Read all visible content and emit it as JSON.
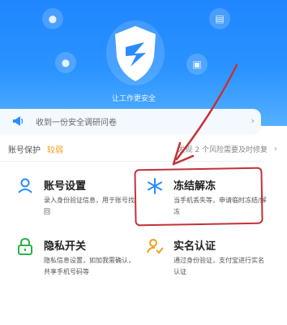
{
  "hero": {
    "slogan": "让工作更安全",
    "colors": {
      "top": "#1f86ff",
      "bottom": "#55b0ff"
    }
  },
  "survey": {
    "icon": "megaphone-icon",
    "text": "收到一份安全调研问卷",
    "arrow": "›"
  },
  "security": {
    "label": "账号保护",
    "level": "较弱",
    "warning": "发现 2 个风险需要及时修复",
    "arrow": "›"
  },
  "cards": [
    {
      "icon": "user-icon",
      "title": "账号设置",
      "desc": "录入身份验证信息，用于账号找回"
    },
    {
      "icon": "snowflake-icon",
      "title": "冻结解冻",
      "desc": "当手机丢失等，申请临时冻结/解冻"
    },
    {
      "icon": "lock-icon",
      "title": "隐私开关",
      "desc": "隐私信息设置，如加我需确认，共享手机号码等"
    },
    {
      "icon": "id-verify-icon",
      "title": "实名认证",
      "desc": "通过身份验证，支付宝进行实名认证"
    }
  ],
  "annotation_color": "#c4323a"
}
